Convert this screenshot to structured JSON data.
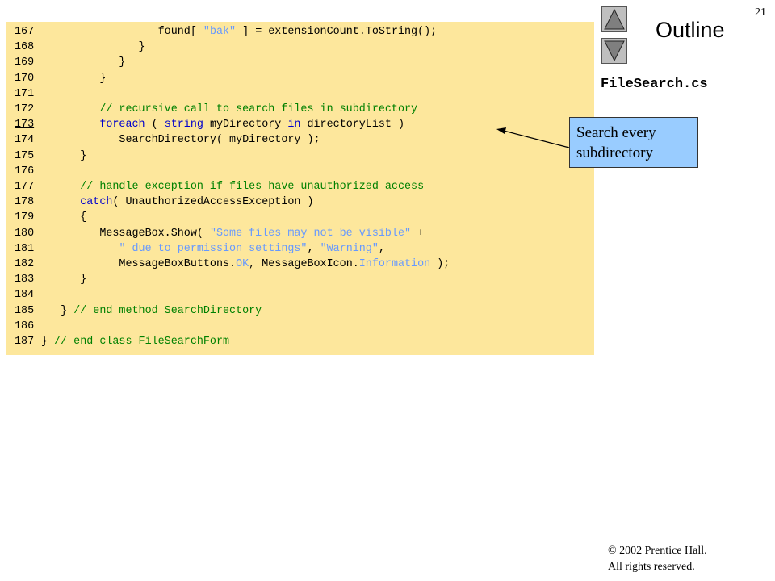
{
  "page_number": "21",
  "outline": {
    "title": "Outline",
    "up_icon": "triangle-up-icon",
    "down_icon": "triangle-down-icon"
  },
  "file_name": "FileSearch.cs",
  "callout": {
    "line1": "Search every",
    "line2": "subdirectory"
  },
  "copyright": {
    "symbol": "©",
    "line1": " 2002 Prentice Hall.",
    "line2": "All rights reserved."
  },
  "colors": {
    "panel": "#fde79c",
    "keyword": "#0000cc",
    "comment": "#008000",
    "string": "#6699ff",
    "callout": "#99ccff"
  },
  "code_lines": [
    {
      "num": "167",
      "segments": [
        {
          "t": "                  found[ "
        },
        {
          "t": "\"bak\"",
          "k": "st"
        },
        {
          "t": " ] = extensionCount.ToString();"
        }
      ]
    },
    {
      "num": "168",
      "segments": [
        {
          "t": "               }"
        }
      ]
    },
    {
      "num": "169",
      "segments": [
        {
          "t": "            }"
        }
      ]
    },
    {
      "num": "170",
      "segments": [
        {
          "t": "         }"
        }
      ]
    },
    {
      "num": "171",
      "segments": []
    },
    {
      "num": "172",
      "segments": [
        {
          "t": "         "
        },
        {
          "t": "// recursive call to search files in subdirectory",
          "k": "cm"
        }
      ]
    },
    {
      "num": "173",
      "underline": true,
      "segments": [
        {
          "t": "         "
        },
        {
          "t": "foreach",
          "k": "kw"
        },
        {
          "t": " ( "
        },
        {
          "t": "string",
          "k": "kw"
        },
        {
          "t": " myDirectory "
        },
        {
          "t": "in",
          "k": "kw"
        },
        {
          "t": " directoryList )"
        }
      ]
    },
    {
      "num": "174",
      "segments": [
        {
          "t": "            SearchDirectory( myDirectory );"
        }
      ]
    },
    {
      "num": "175",
      "segments": [
        {
          "t": "      }"
        }
      ]
    },
    {
      "num": "176",
      "segments": []
    },
    {
      "num": "177",
      "segments": [
        {
          "t": "      "
        },
        {
          "t": "// handle exception if files have unauthorized access",
          "k": "cm"
        }
      ]
    },
    {
      "num": "178",
      "segments": [
        {
          "t": "      "
        },
        {
          "t": "catch",
          "k": "kw"
        },
        {
          "t": "( UnauthorizedAccessException )"
        }
      ]
    },
    {
      "num": "179",
      "segments": [
        {
          "t": "      {"
        }
      ]
    },
    {
      "num": "180",
      "segments": [
        {
          "t": "         MessageBox.Show( "
        },
        {
          "t": "\"Some files may not be visible\"",
          "k": "st"
        },
        {
          "t": " +"
        }
      ]
    },
    {
      "num": "181",
      "segments": [
        {
          "t": "            "
        },
        {
          "t": "\" due to permission settings\"",
          "k": "st"
        },
        {
          "t": ", "
        },
        {
          "t": "\"Warning\"",
          "k": "st"
        },
        {
          "t": ","
        }
      ]
    },
    {
      "num": "182",
      "segments": [
        {
          "t": "            MessageBoxButtons."
        },
        {
          "t": "OK",
          "k": "st"
        },
        {
          "t": ", MessageBoxIcon."
        },
        {
          "t": "Information",
          "k": "st"
        },
        {
          "t": " );"
        }
      ]
    },
    {
      "num": "183",
      "segments": [
        {
          "t": "      }"
        }
      ]
    },
    {
      "num": "184",
      "segments": []
    },
    {
      "num": "185",
      "segments": [
        {
          "t": "   } "
        },
        {
          "t": "// end method SearchDirectory",
          "k": "cm"
        }
      ]
    },
    {
      "num": "186",
      "segments": []
    },
    {
      "num": "187",
      "segments": [
        {
          "t": "} "
        },
        {
          "t": "// end class FileSearchForm",
          "k": "cm"
        }
      ]
    }
  ]
}
